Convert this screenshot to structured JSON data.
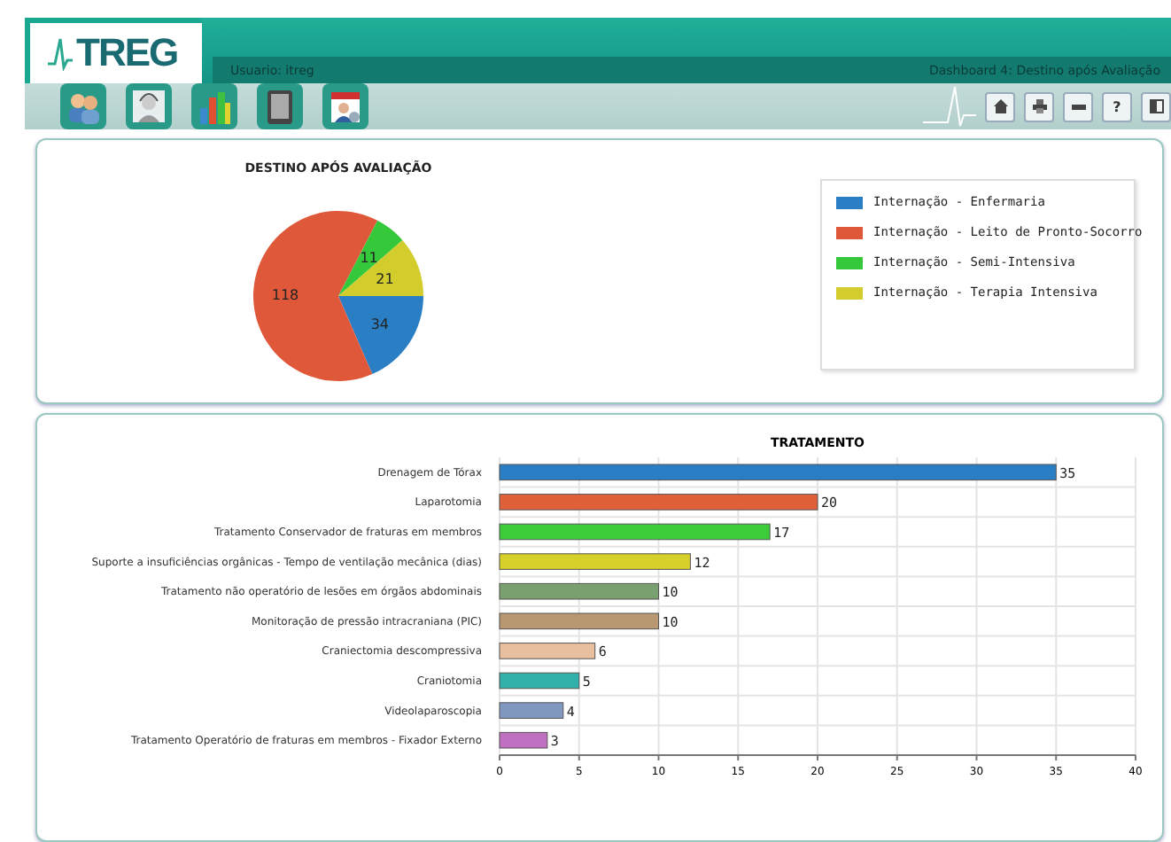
{
  "header": {
    "logo": "TREG",
    "user": "Usuario: itreg",
    "dashboard": "Dashboard 4: Destino após Avaliação"
  },
  "toolbar": {
    "apps": [
      {
        "kind": "people"
      },
      {
        "kind": "doctor"
      },
      {
        "kind": "chart"
      },
      {
        "kind": "tablet"
      },
      {
        "kind": "calendar"
      }
    ],
    "buttons": [
      {
        "kind": "home"
      },
      {
        "kind": "print"
      },
      {
        "kind": "minimize"
      },
      {
        "kind": "help",
        "text": "?"
      },
      {
        "kind": "exit"
      }
    ]
  },
  "destino": {
    "chart_data": {
      "type": "pie",
      "title": "DESTINO APÓS AVALIAÇÃO",
      "categories": [
        "Internação - Enfermaria",
        "Internação - Leito de Pronto-Socorro",
        "Internação - Semi-Intensiva",
        "Internação - Terapia Intensiva"
      ],
      "values": [
        34,
        118,
        11,
        21
      ],
      "colors": [
        "#2a7fc4",
        "#e0583a",
        "#34c83a",
        "#d2cc2c"
      ],
      "data_labels": true
    }
  },
  "tratamento": {
    "chart_data": {
      "type": "bar",
      "orientation": "horizontal",
      "title": "TRATAMENTO",
      "categories": [
        "Drenagem de Tórax",
        "Laparotomia",
        "Tratamento Conservador de fraturas em membros",
        "Suporte a insuficiências orgânicas - Tempo de ventilação mecânica (dias)",
        "Tratamento não operatório de lesões em órgãos abdominais",
        "Monitoração de pressão intracraniana (PIC)",
        "Craniectomia descompressiva",
        "Craniotomia",
        "Videolaparoscopia",
        "Tratamento Operatório de fraturas em membros - Fixador Externo"
      ],
      "values": [
        35,
        20,
        17,
        12,
        10,
        10,
        6,
        5,
        4,
        3
      ],
      "colors": [
        "#2a7fc4",
        "#e0603a",
        "#3ccc3a",
        "#d8d02a",
        "#7aa070",
        "#b89870",
        "#e8c0a0",
        "#30b0a8",
        "#8098c0",
        "#c070c0"
      ],
      "xlim": [
        0,
        40
      ],
      "grid": true,
      "xticks": [
        0,
        5,
        10,
        15,
        20,
        25,
        30,
        35,
        40
      ],
      "data_labels": true
    }
  }
}
